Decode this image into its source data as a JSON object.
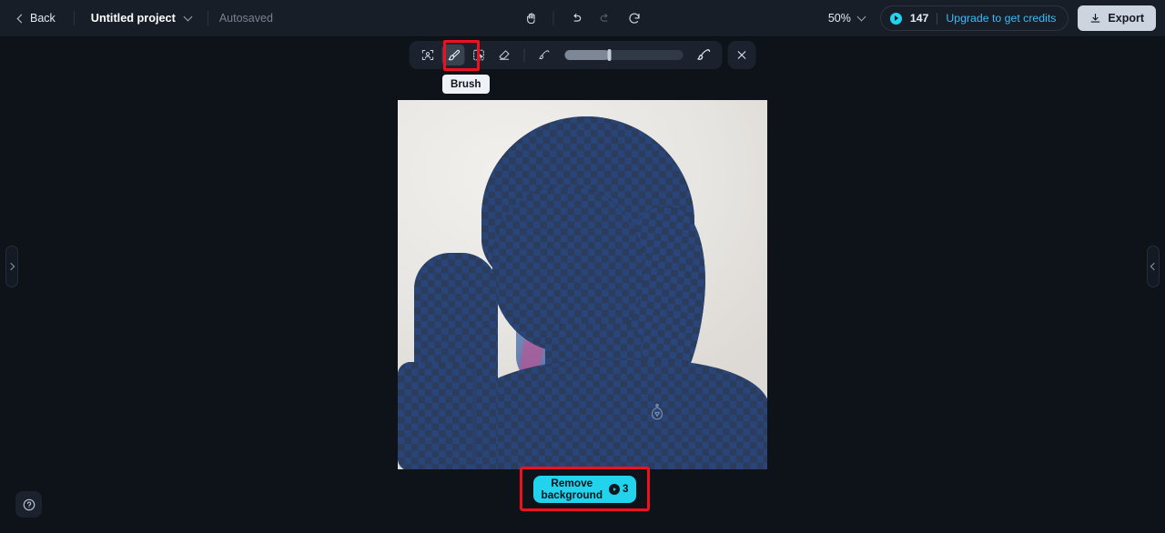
{
  "topbar": {
    "back_label": "Back",
    "back_icon": "chevron-left-icon",
    "project_name": "Untitled project",
    "project_caret_icon": "chevron-down-icon",
    "save_status": "Autosaved",
    "center_tools": [
      {
        "name": "hand-tool-icon",
        "label": "Pan"
      },
      {
        "name": "undo-icon",
        "label": "Undo"
      },
      {
        "name": "redo-icon",
        "label": "Redo"
      },
      {
        "name": "reset-icon",
        "label": "Reset"
      }
    ],
    "zoom_level": "50%",
    "zoom_caret_icon": "chevron-down-icon",
    "credits_icon": "credit-coin-icon",
    "credits_count": "147",
    "upgrade_label": "Upgrade to get credits",
    "export_icon": "download-icon",
    "export_label": "Export"
  },
  "panels": {
    "left_handle_icon": "chevron-right-icon",
    "right_handle_icon": "chevron-left-icon"
  },
  "toolbar": {
    "tools": [
      {
        "name": "subject-select-icon",
        "label": "Select subject",
        "active": false
      },
      {
        "name": "brush-icon",
        "label": "Brush",
        "active": true
      },
      {
        "name": "magic-select-icon",
        "label": "Magic select",
        "active": false
      },
      {
        "name": "eraser-icon",
        "label": "Eraser",
        "active": false
      }
    ],
    "brush_small_icon": "brush-small-icon",
    "brush_large_icon": "brush-large-icon",
    "brush_size_percent": "38",
    "close_icon": "close-icon",
    "tooltip_label": "Brush"
  },
  "canvas": {
    "photo_alt": "Singer at vintage microphone",
    "watermark_icon": "brand-watermark-icon",
    "mask_color": "#2f508f",
    "brush_stroke_color": "#d1498f"
  },
  "actions": {
    "remove_bg_line1": "Remove",
    "remove_bg_line2": "background",
    "remove_bg_cost_icon": "credit-coin-icon",
    "remove_bg_cost": "3",
    "highlight_color": "#ef1020"
  },
  "help": {
    "icon": "help-circle-icon",
    "label": "Help"
  }
}
